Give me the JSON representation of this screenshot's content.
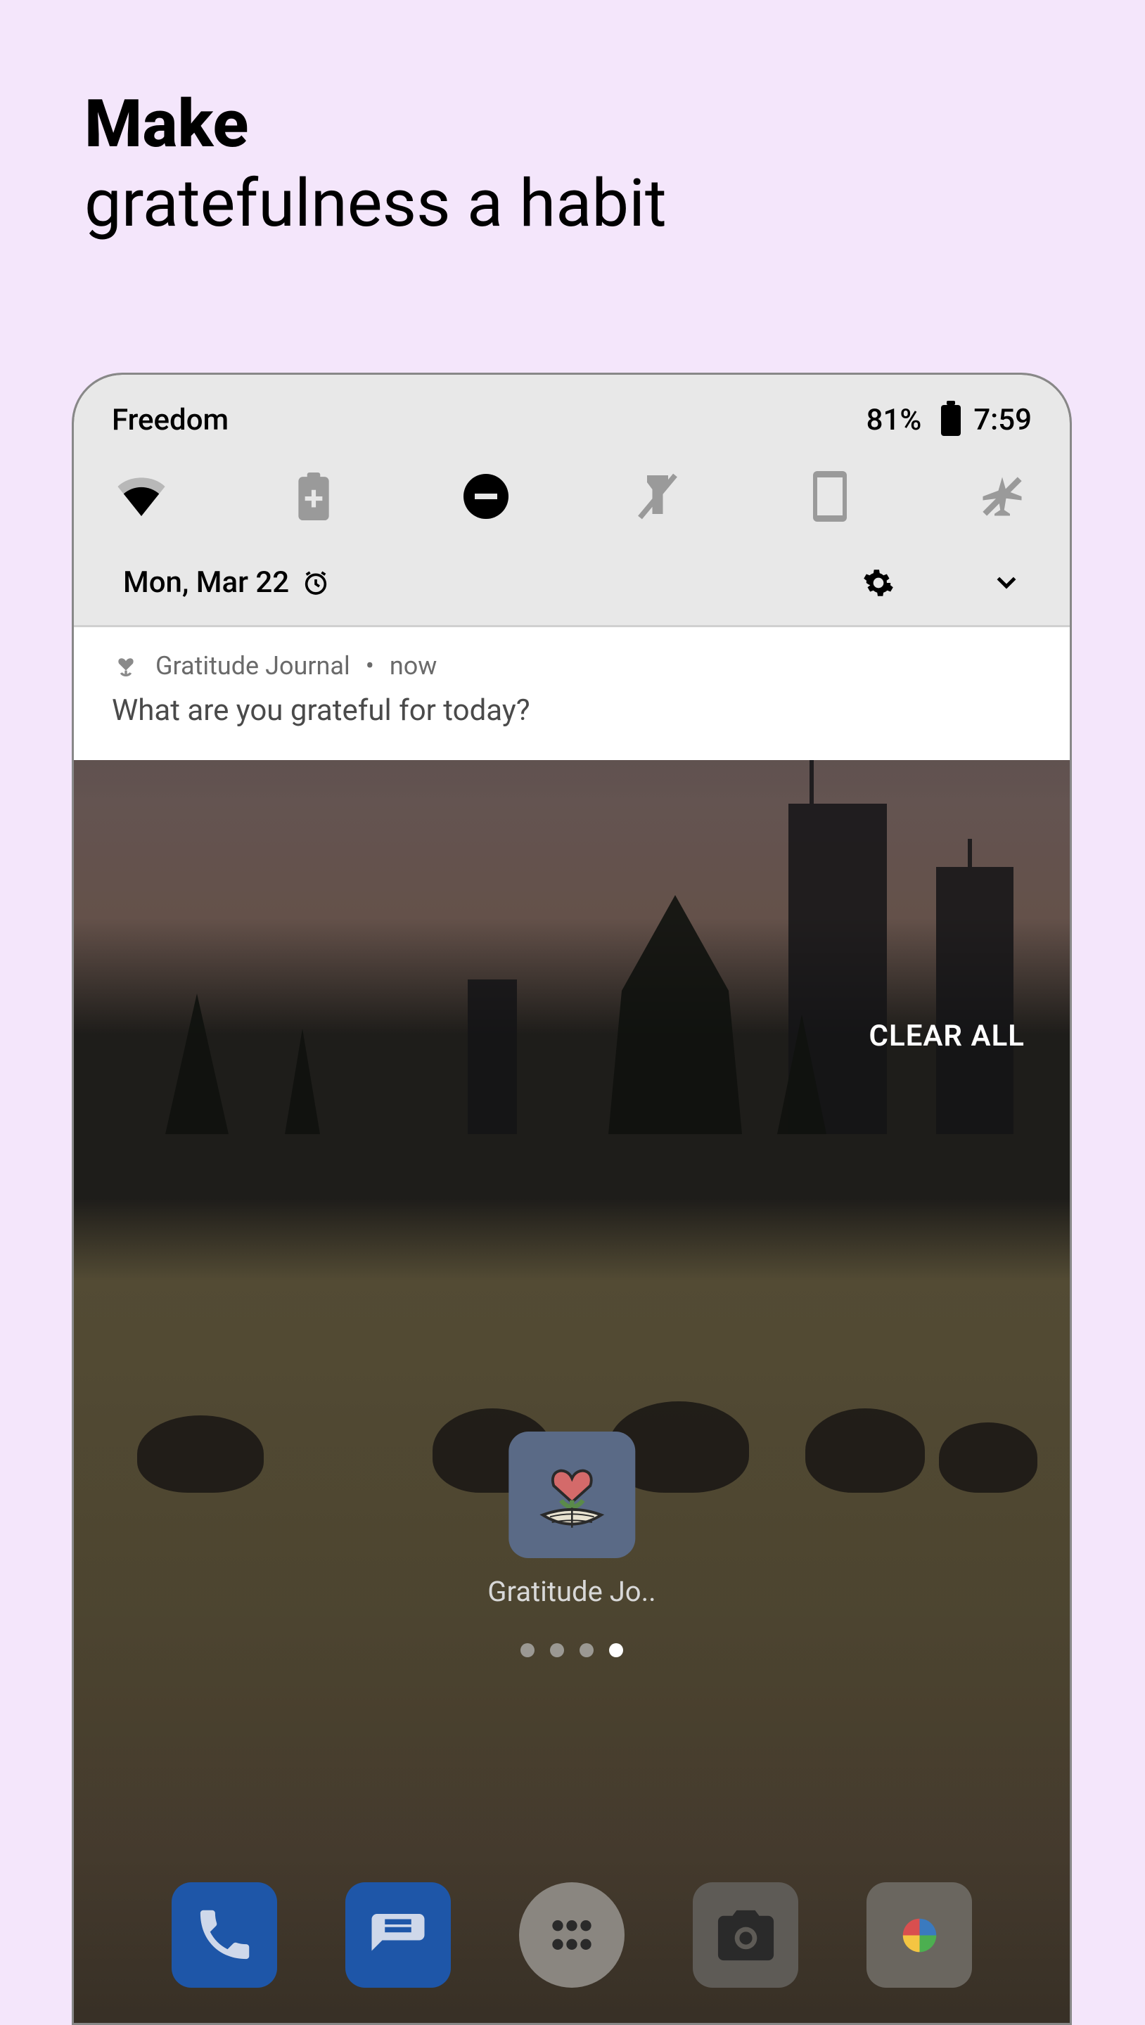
{
  "promo": {
    "bold": "Make",
    "light": "gratefulness a habit"
  },
  "status": {
    "carrier": "Freedom",
    "battery": "81%",
    "time": "7:59"
  },
  "qs": {
    "wifi": "wifi-icon",
    "battery_saver": "battery-saver-icon",
    "dnd": "do-not-disturb-icon",
    "flashlight": "flashlight-off-icon",
    "rotation": "portrait-lock-icon",
    "airplane": "airplane-off-icon"
  },
  "date": "Mon, Mar 22",
  "notification": {
    "app": "Gratitude Journal",
    "sep": "•",
    "time": "now",
    "body": "What are you grateful for today?"
  },
  "clear_all": "CLEAR ALL",
  "home_app": {
    "label": "Gratitude Jo.."
  },
  "page_indicator": {
    "count": 4,
    "active": 3
  },
  "dock": {
    "phone": "phone-icon",
    "messages": "messages-icon",
    "drawer": "app-drawer-icon",
    "camera": "camera-icon",
    "photos": "google-photos-icon"
  }
}
